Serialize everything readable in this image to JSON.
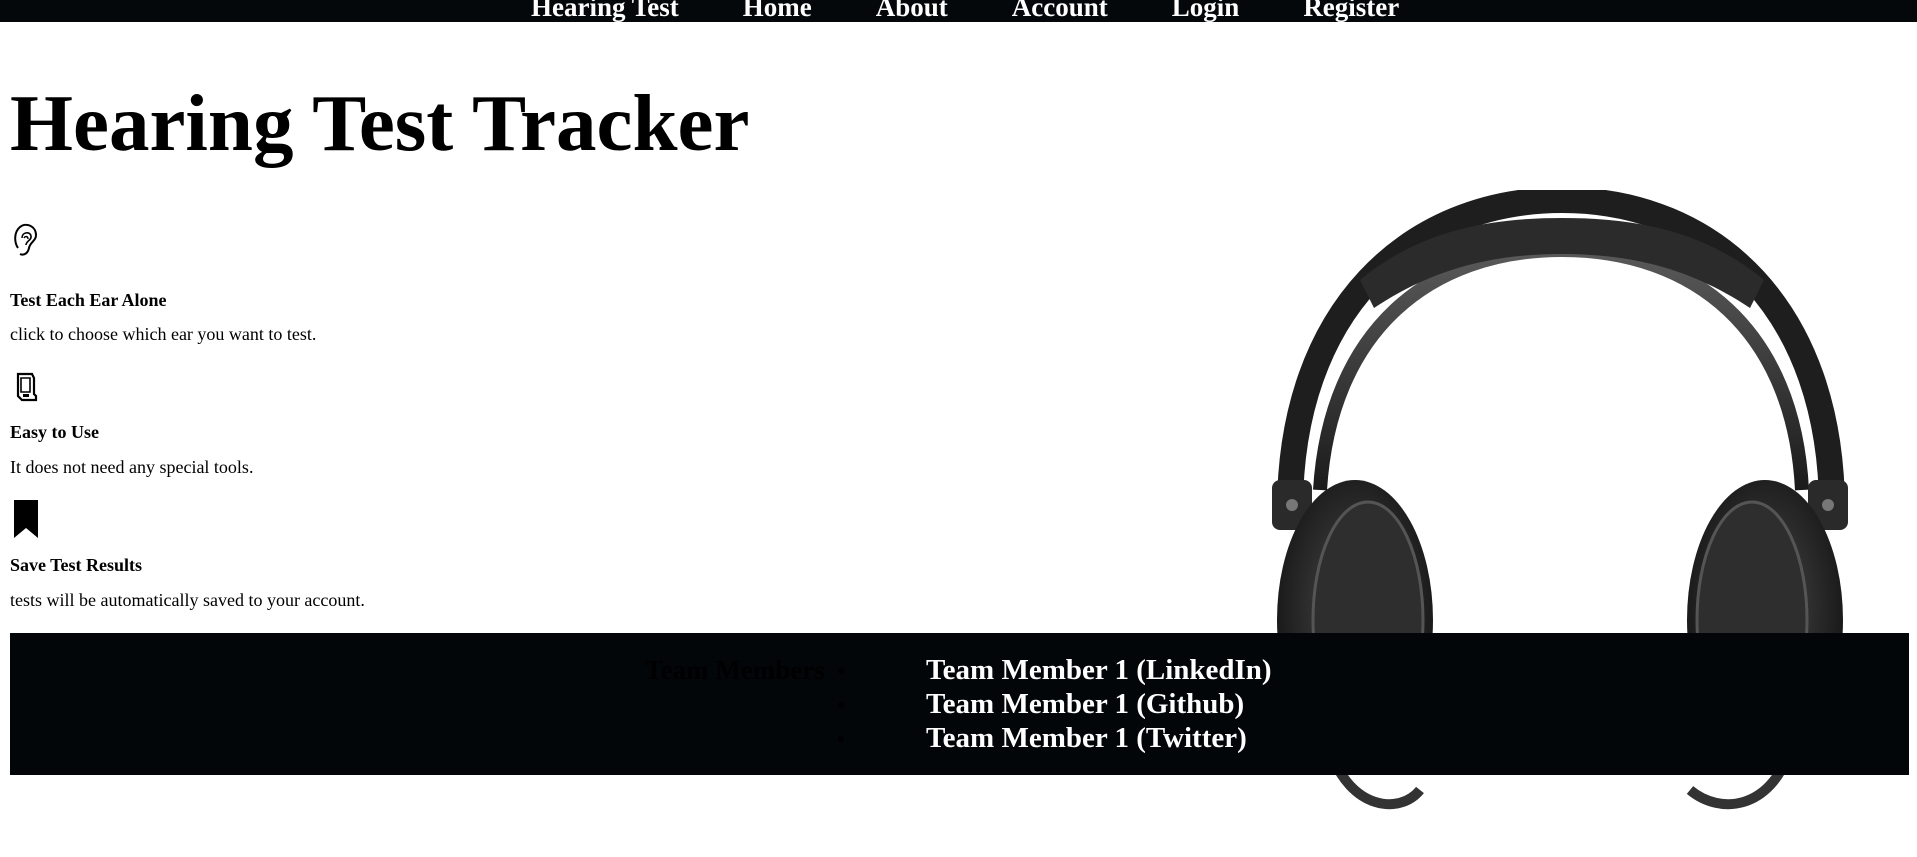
{
  "nav": {
    "items": [
      {
        "label": "Hearing Test"
      },
      {
        "label": "Home"
      },
      {
        "label": "About"
      },
      {
        "label": "Account"
      },
      {
        "label": "Login"
      },
      {
        "label": "Register"
      }
    ]
  },
  "main": {
    "title": "Hearing Test Tracker",
    "features": [
      {
        "icon": "ear-icon",
        "heading": "Test Each Ear Alone",
        "description": "click to choose which ear you want to test."
      },
      {
        "icon": "hand-pointer-icon",
        "heading": "Easy to Use",
        "description": "It does not need any special tools."
      },
      {
        "icon": "bookmark-icon",
        "heading": "Save Test Results",
        "description": "tests will be automatically saved to your account."
      }
    ],
    "image": {
      "icon": "headphones-image"
    }
  },
  "footer": {
    "team_heading": "Team Members",
    "links": [
      {
        "label": "Team Member 1 (LinkedIn)"
      },
      {
        "label": "Team Member 1 (Github)"
      },
      {
        "label": "Team Member 1 (Twitter)"
      }
    ]
  },
  "colors": {
    "nav_background": "#05080a",
    "footer_background": "#020609",
    "text": "#000000",
    "link_text": "#ffffff"
  }
}
